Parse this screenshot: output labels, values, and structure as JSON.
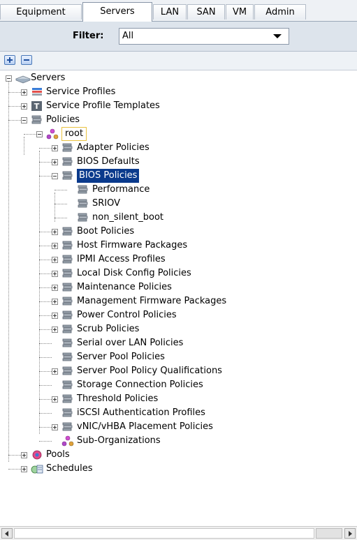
{
  "tabs": [
    "Equipment",
    "Servers",
    "LAN",
    "SAN",
    "VM",
    "Admin"
  ],
  "active_tab": "Servers",
  "filter": {
    "label": "Filter:",
    "value": "All"
  },
  "toolbar": {
    "expand": "expand-all",
    "collapse": "collapse-all"
  },
  "tree": [
    {
      "label": "Servers",
      "icon": "servers-icon",
      "expander": "minus"
    },
    {
      "label": "Service Profiles",
      "icon": "service-profiles-icon",
      "expander": "plus"
    },
    {
      "label": "Service Profile Templates",
      "icon": "template-icon",
      "expander": "plus"
    },
    {
      "label": "Policies",
      "icon": "policy-icon",
      "expander": "minus"
    },
    {
      "label": "root",
      "icon": "org-icon",
      "expander": "minus"
    },
    {
      "label": "Adapter Policies",
      "icon": "policy-icon",
      "expander": "plus"
    },
    {
      "label": "BIOS Defaults",
      "icon": "policy-icon",
      "expander": "plus"
    },
    {
      "label": "BIOS Policies",
      "icon": "policy-icon",
      "expander": "minus",
      "selected": true
    },
    {
      "label": "Performance",
      "icon": "policy-icon"
    },
    {
      "label": "SRIOV",
      "icon": "policy-icon"
    },
    {
      "label": "non_silent_boot",
      "icon": "policy-icon"
    },
    {
      "label": "Boot Policies",
      "icon": "policy-icon",
      "expander": "plus"
    },
    {
      "label": "Host Firmware Packages",
      "icon": "policy-icon",
      "expander": "plus"
    },
    {
      "label": "IPMI Access Profiles",
      "icon": "policy-icon",
      "expander": "plus"
    },
    {
      "label": "Local Disk Config Policies",
      "icon": "policy-icon",
      "expander": "plus"
    },
    {
      "label": "Maintenance Policies",
      "icon": "policy-icon",
      "expander": "plus"
    },
    {
      "label": "Management Firmware Packages",
      "icon": "policy-icon",
      "expander": "plus"
    },
    {
      "label": "Power Control Policies",
      "icon": "policy-icon",
      "expander": "plus"
    },
    {
      "label": "Scrub Policies",
      "icon": "policy-icon",
      "expander": "plus"
    },
    {
      "label": "Serial over LAN Policies",
      "icon": "policy-icon"
    },
    {
      "label": "Server Pool Policies",
      "icon": "policy-icon"
    },
    {
      "label": "Server Pool Policy Qualifications",
      "icon": "policy-icon",
      "expander": "plus"
    },
    {
      "label": "Storage Connection Policies",
      "icon": "policy-icon"
    },
    {
      "label": "Threshold Policies",
      "icon": "policy-icon",
      "expander": "plus"
    },
    {
      "label": "iSCSI Authentication Profiles",
      "icon": "policy-icon"
    },
    {
      "label": "vNIC/vHBA Placement Policies",
      "icon": "policy-icon",
      "expander": "plus"
    },
    {
      "label": "Sub-Organizations",
      "icon": "org-icon"
    },
    {
      "label": "Pools",
      "icon": "pools-icon",
      "expander": "plus"
    },
    {
      "label": "Schedules",
      "icon": "schedules-icon",
      "expander": "plus"
    }
  ]
}
